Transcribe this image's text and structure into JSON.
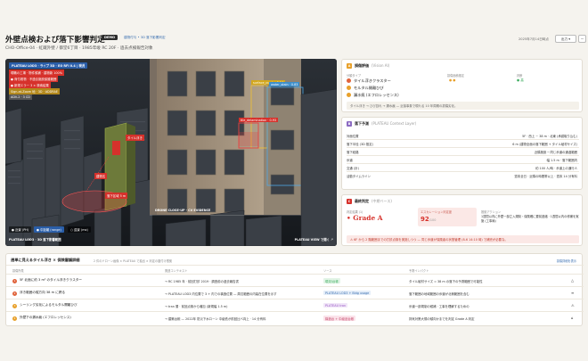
{
  "header": {
    "title": "外壁点検および落下影響判定",
    "badge": "DEMO",
    "tag_link": "建物付与 • 3D 落下影響判定",
    "subtitle": "CHO-Office-04 · 虹蔵外壁 / 御堂6丁目 · 1985年竣 RC 20F · 過去点検報告対象",
    "date": "2025年7月14日時点",
    "export_label": "出力 ▾",
    "more_label": "···"
  },
  "scene": {
    "top_label": "PLATEAU LOD3 · ライブ 3D · EO RFI 0.4 | 現況",
    "legend": [
      "現職の工場 · 物件候補 · 建物新 100%",
      "● 商付着物 · 不連合施設保護範囲",
      "● 新規エラー 3 × 検索結果",
      "Sign-at-Zoom 地 · 3D · ADDRAE",
      "ADV-2 · 3 CD"
    ],
    "bldg_label": "タイル浮き",
    "bldg_label2": "建物名",
    "fall_label": "落下区域 5 m",
    "cv_label1": "surface_crack · 0.94",
    "cv_label2": "water_stain · 0.83",
    "cv_label3": "tile_delamination · 0.93",
    "cv_caption": "DRONE CLOSE-UP · CV EVIDENCE",
    "footer_left": "PLATEAU LOD3 · 3D 落下影響範囲",
    "footer_right": "PLATEAU VIEW で開く ↗",
    "controls": [
      "● 近景 (PH)",
      "● 中距離 (range)",
      "○ 遠景 (mx)"
    ]
  },
  "p1": {
    "num": "A",
    "title": "損傷評価",
    "sub": "(Vision AI)",
    "col2": "損傷面積推定",
    "col3": "判断",
    "col1": "分類タイプ",
    "items": [
      {
        "label": "タイル浮きクラスター",
        "color": "#e0633b",
        "v2": "● ●",
        "v3": "● 高"
      },
      {
        "label": "モルタル開離ひび",
        "color": "#e8a02a",
        "v2": "",
        "v3": ""
      },
      {
        "label": "漏水痕 (エフロレッセンス)",
        "color": "#e8a02a",
        "v2": "",
        "v3": ""
      }
    ],
    "note": "タイル浮き → ひび割れ → 漏水痕 — 近接事象で現れる 10 年周期の損傷劣化。"
  },
  "p2": {
    "num": "B",
    "title": "落下予測",
    "sub": "(PLATEAU Context Layer)",
    "rows": [
      {
        "k": "対面位置",
        "v": "5F · 西上 ~ 38 m · 北東 (承認取り込む)"
      },
      {
        "k": "落下半径 (3D 推定)",
        "v": "6 m (建物全面の落下範囲 + タイル破材サイズ)"
      },
      {
        "k": "落下経路",
        "v": "近隣施設 ─ 同じ歩道の通過範囲"
      },
      {
        "k": "歩道",
        "v": "幅 1.5 m · 落下範囲内"
      },
      {
        "k": "交通 (計)",
        "v": "約 100 人/時 · 歩道上の通行人"
      },
      {
        "k": "活動タイムライン",
        "v": "週末全日 · 近隣の時間帯以上 · 週末 14 分有料"
      }
    ]
  },
  "p3": {
    "num": "C",
    "title": "最終判定",
    "sub": "(中期ベース)",
    "grade_label": "判定結果 (1)",
    "grade": "• Grade A",
    "score_label": "エスカレーション判定度",
    "score": "92",
    "score_max": "/100",
    "action_label": "推奨アクション",
    "action": "1週間以内に外壁一部立入規制・保険確に要前連絡 · 1週間以内の修補を実施 (工事局)",
    "alert": "6F から 2 階範囲までの打診点検を実施しつつ — 同じ歩道が保険者の状態管理 (8-6 14:10 時) で補完が必要な。"
  },
  "table": {
    "title": "週単に見えるタイル浮き × 保険審議詳細",
    "title_note": "2 件のドローン画像 × PLATEAU で抽出 × 判定の裏付け根拠",
    "right_link": "損傷詳細を表示",
    "headers": [
      "損傷所見",
      "関連コンテキスト",
      "ソース",
      "予測インパクト"
    ],
    "rows": [
      {
        "n": "1",
        "c": "#e0633b",
        "finding": "5F 北面に約 3 m² のタイル浮きクラスター",
        "ctx": "→ RC 1985 年 · 前回打診 2019 · 調査前の過去報告書",
        "src": "現況/台帳",
        "src_c": "#3fae61",
        "impact": "タイル破材サイズ = 38 m の落下の予測範囲で可能性",
        "ic": "△"
      },
      {
        "n": "2",
        "c": "#e0633b",
        "finding": "浮き範囲の縦方向 38 m に跨る",
        "ctx": "→ PLATEAU LOD3 内位置で 3 + 内での構造位置 — 周辺範囲の内装在位置を示す",
        "src": "PLATEAU LOD3 + Bldg usage",
        "src_c": "#3a6fb0",
        "impact": "落下範囲の地域範囲の歩道が北側範囲を含む",
        "ic": "≡"
      },
      {
        "n": "3",
        "c": "#e8a02a",
        "finding": "シーリング劣化によるモルタル開離ひび",
        "ctx": "→ tran 層 · 前回点検から増加 (新規幅 1.5 m)",
        "src": "PLATEAU tran",
        "src_c": "#9a5cc6",
        "impact": "歩道一部規制の候補 · 工事を理解するための",
        "ic": "⚠"
      },
      {
        "n": "4",
        "c": "#e8a02a",
        "finding": "外壁下の漏水痕 (エフロレッセンス)",
        "ctx": "→ 建築台帳 — 2022年 防災下水ローン 中級低が前回比べ向上 · 14 分有料",
        "src": "構造台 + 中級品台帳",
        "src_c": "#c4466a",
        "impact": "排気対策大規の傾向かまでを判定 Grade A 判定",
        "ic": "⌂"
      }
    ]
  }
}
